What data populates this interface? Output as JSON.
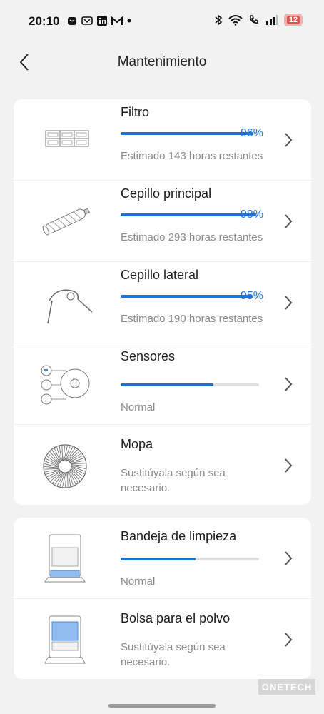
{
  "status_bar": {
    "time": "20:10",
    "battery": "12"
  },
  "header": {
    "title": "Mantenimiento"
  },
  "items": [
    {
      "name": "Filtro",
      "percent_text": "96%",
      "level": 0.96,
      "description": "Estimado 143 horas restantes",
      "icon": "filter-icon"
    },
    {
      "name": "Cepillo principal",
      "percent_text": "98%",
      "level": 0.98,
      "description": "Estimado 293 horas restantes",
      "icon": "main-brush-icon"
    },
    {
      "name": "Cepillo lateral",
      "percent_text": "95%",
      "level": 0.95,
      "description": "Estimado 190 horas restantes",
      "icon": "side-brush-icon"
    },
    {
      "name": "Sensores",
      "level": 0.67,
      "description": "Normal",
      "icon": "sensors-icon"
    },
    {
      "name": "Mopa",
      "description": "Sustitúyala según sea necesario.",
      "icon": "mop-icon"
    }
  ],
  "station_items": [
    {
      "name": "Bandeja de limpieza",
      "level": 0.54,
      "description": "Normal",
      "icon": "cleaning-tray-icon"
    },
    {
      "name": "Bolsa para el polvo",
      "description": "Sustitúyala según sea necesario.",
      "icon": "dust-bag-icon"
    }
  ],
  "watermark": "ONETECH",
  "colors": {
    "progress_fill": "#1e6fd9",
    "percent_text": "#1e78d8",
    "background": "#f2f2f2"
  }
}
